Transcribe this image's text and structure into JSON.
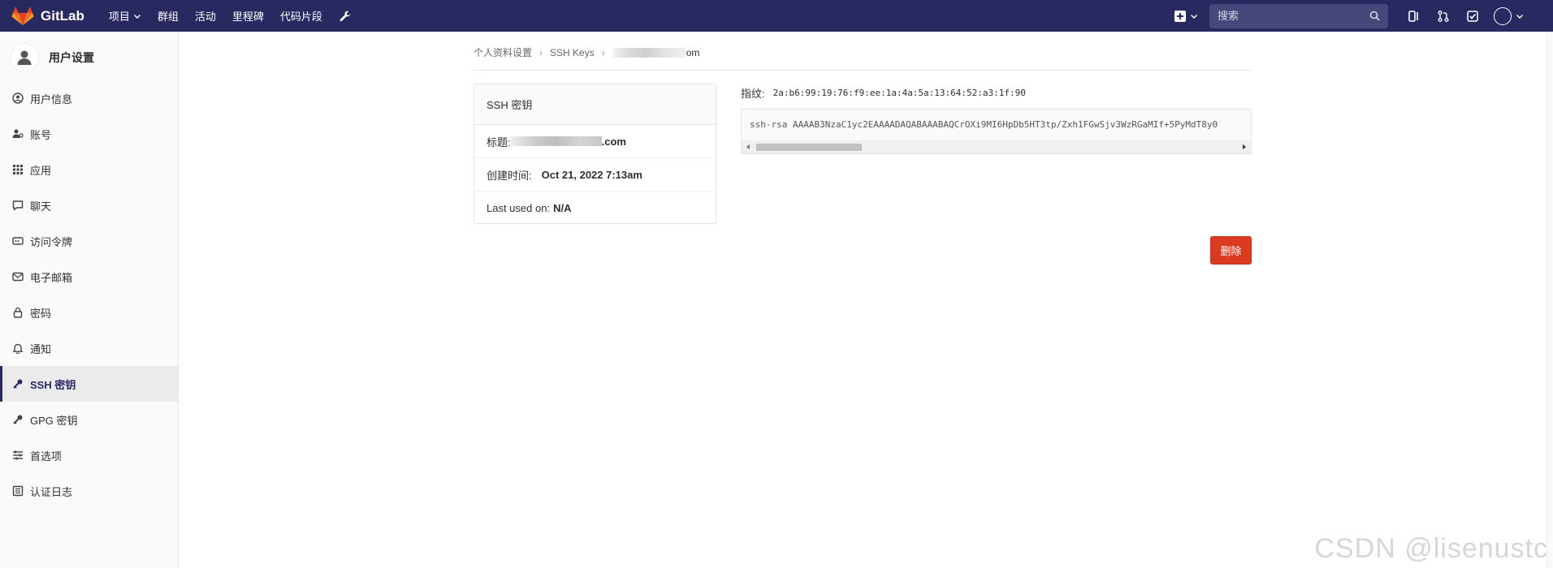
{
  "navbar": {
    "brand": "GitLab",
    "links": [
      {
        "label": "项目",
        "has_dropdown": true
      },
      {
        "label": "群组"
      },
      {
        "label": "活动"
      },
      {
        "label": "里程碑"
      },
      {
        "label": "代码片段"
      }
    ],
    "search_placeholder": "搜索",
    "colors": {
      "background": "#292961",
      "search_bg": "#47477b"
    }
  },
  "sidebar": {
    "title": "用户设置",
    "items": [
      {
        "label": "用户信息",
        "icon": "user-circle-icon"
      },
      {
        "label": "账号",
        "icon": "account-icon"
      },
      {
        "label": "应用",
        "icon": "apps-grid-icon"
      },
      {
        "label": "聊天",
        "icon": "chat-icon"
      },
      {
        "label": "访问令牌",
        "icon": "token-icon"
      },
      {
        "label": "电子邮箱",
        "icon": "mail-icon"
      },
      {
        "label": "密码",
        "icon": "lock-icon"
      },
      {
        "label": "通知",
        "icon": "bell-icon"
      },
      {
        "label": "SSH 密钥",
        "icon": "key-icon",
        "active": true
      },
      {
        "label": "GPG 密钥",
        "icon": "key-icon"
      },
      {
        "label": "首选项",
        "icon": "sliders-icon"
      },
      {
        "label": "认证日志",
        "icon": "log-icon"
      }
    ]
  },
  "breadcrumb": {
    "items": [
      "个人资料设置",
      "SSH Keys"
    ],
    "current_suffix": "om"
  },
  "key_card": {
    "header": "SSH 密钥",
    "title_label": "标题:",
    "title_suffix": ".com",
    "created_label": "创建时间:",
    "created_value": "Oct 21, 2022 7:13am",
    "last_used_label": "Last used on:",
    "last_used_value": "N/A"
  },
  "fingerprint": {
    "label": "指纹:",
    "value": "2a:b6:99:19:76:f9:ee:1a:4a:5a:13:64:52:a3:1f:90"
  },
  "key_text": "ssh-rsa AAAAB3NzaC1yc2EAAAADAQABAAABAQCrOXi9MI6HpDb5HT3tp/Zxh1FGwSjv3WzRGaMIf+5PyMdT8y0",
  "delete_label": "删除",
  "watermark": "CSDN @lisenustc",
  "colors": {
    "danger": "#db3b21",
    "active_accent": "#292961"
  }
}
